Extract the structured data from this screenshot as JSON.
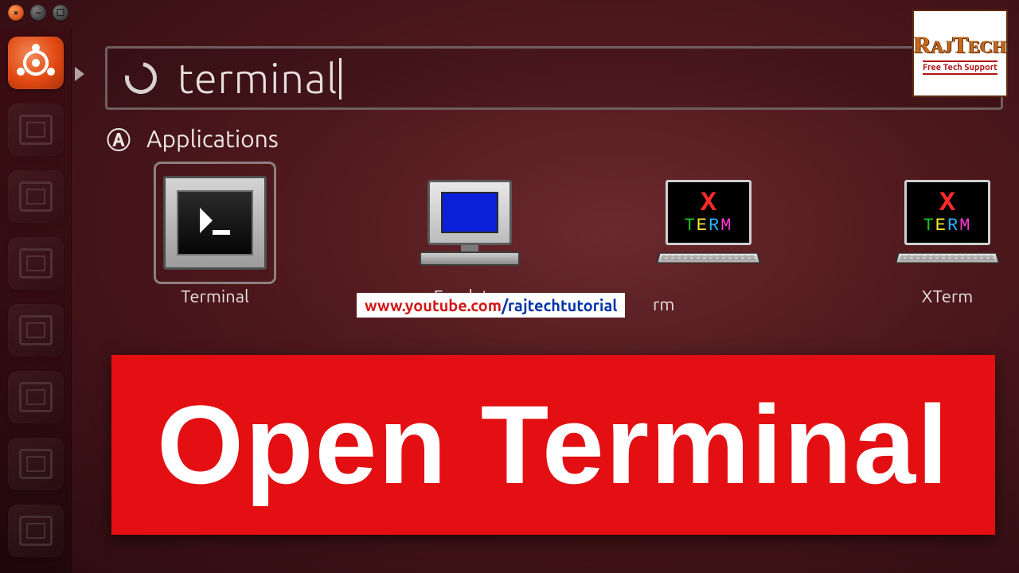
{
  "search": {
    "query": "terminal"
  },
  "section": {
    "title": "Applications"
  },
  "apps": [
    {
      "label": "Terminal"
    },
    {
      "label": "Emulator"
    },
    {
      "label_suffix": "rm"
    },
    {
      "label": "XTerm"
    }
  ],
  "overlay_url": {
    "part1": "www.youtube.com",
    "part2": "/rajtechtutorial"
  },
  "banner": {
    "text": "Open Terminal"
  },
  "brand": {
    "line1a": "R",
    "line1b": "AJ",
    "line1c": "T",
    "line1d": "ECH",
    "line2": "Free Tech Support"
  },
  "xterm_glyph": {
    "x": "X",
    "t": "T",
    "e": "E",
    "r": "R",
    "m": "M"
  }
}
